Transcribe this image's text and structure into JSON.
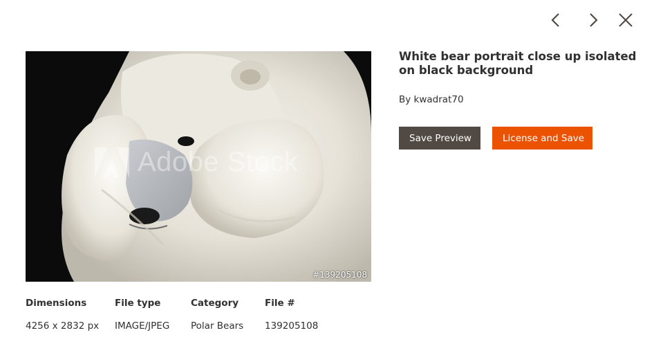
{
  "navigation": {
    "prev_icon": "chevron-left-icon",
    "next_icon": "chevron-right-icon",
    "close_icon": "close-icon"
  },
  "preview": {
    "watermark": "Adobe Stock",
    "file_badge": "#139205108"
  },
  "details": {
    "title": "White bear portrait close up isolated on black background",
    "author": "By kwadrat70",
    "save_preview_label": "Save Preview",
    "license_save_label": "License and Save"
  },
  "meta": [
    {
      "label": "Dimensions",
      "value": "4256 x 2832 px"
    },
    {
      "label": "File type",
      "value": "IMAGE/JPEG"
    },
    {
      "label": "Category",
      "value": "Polar Bears"
    },
    {
      "label": "File #",
      "value": "139205108"
    }
  ],
  "colors": {
    "primary_button": "#514943",
    "accent_button": "#eb5202",
    "text": "#303030",
    "icon": "#514943"
  }
}
